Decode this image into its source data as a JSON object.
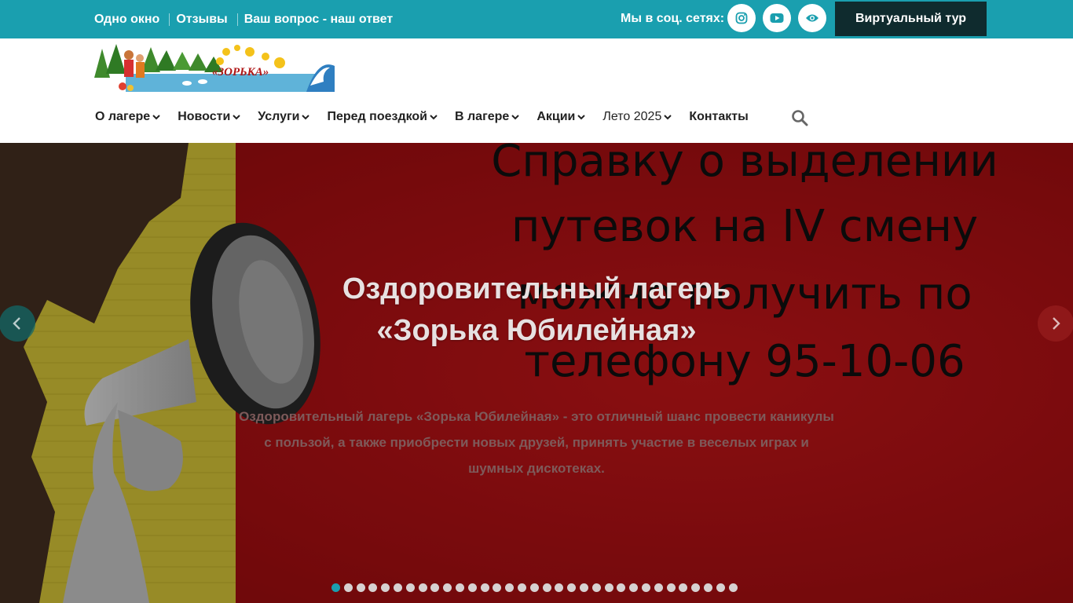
{
  "topbar": {
    "links": [
      "Одно окно",
      "Отзывы",
      "Ваш вопрос - наш ответ"
    ],
    "social_label": "Мы в соц. сетях:",
    "social_icons": [
      "instagram-icon",
      "youtube-icon",
      "eye-icon"
    ],
    "tour_button": "Виртуальный тур",
    "color": "#1a9faf"
  },
  "logo": {
    "text": "«ЗОРЬКА»"
  },
  "nav": {
    "items": [
      {
        "label": "О лагере",
        "has_dropdown": true
      },
      {
        "label": "Новости",
        "has_dropdown": true
      },
      {
        "label": "Услуги",
        "has_dropdown": true
      },
      {
        "label": "Перед поездкой",
        "has_dropdown": true
      },
      {
        "label": "В лагере",
        "has_dropdown": true
      },
      {
        "label": "Акции",
        "has_dropdown": true
      },
      {
        "label": "Лето 2025",
        "has_dropdown": true
      },
      {
        "label": "Контакты",
        "has_dropdown": false
      }
    ],
    "search_icon": "search-icon"
  },
  "slider": {
    "poster_lines": [
      "Справку о выделении",
      "путевок на IV смену",
      "можно получить по",
      "телефону 95-10-06"
    ],
    "title_line1": "Оздоровительный лагерь",
    "title_line2": "«Зорька Юбилейная»",
    "description": "Оздоровительный лагерь «Зорька Юбилейная» - это отличный шанс провести каникулы с пользой, а также приобрести новых друзей, принять участие в веселых играх и шумных дискотеках.",
    "dots_count": 33,
    "active_dot": 1
  }
}
